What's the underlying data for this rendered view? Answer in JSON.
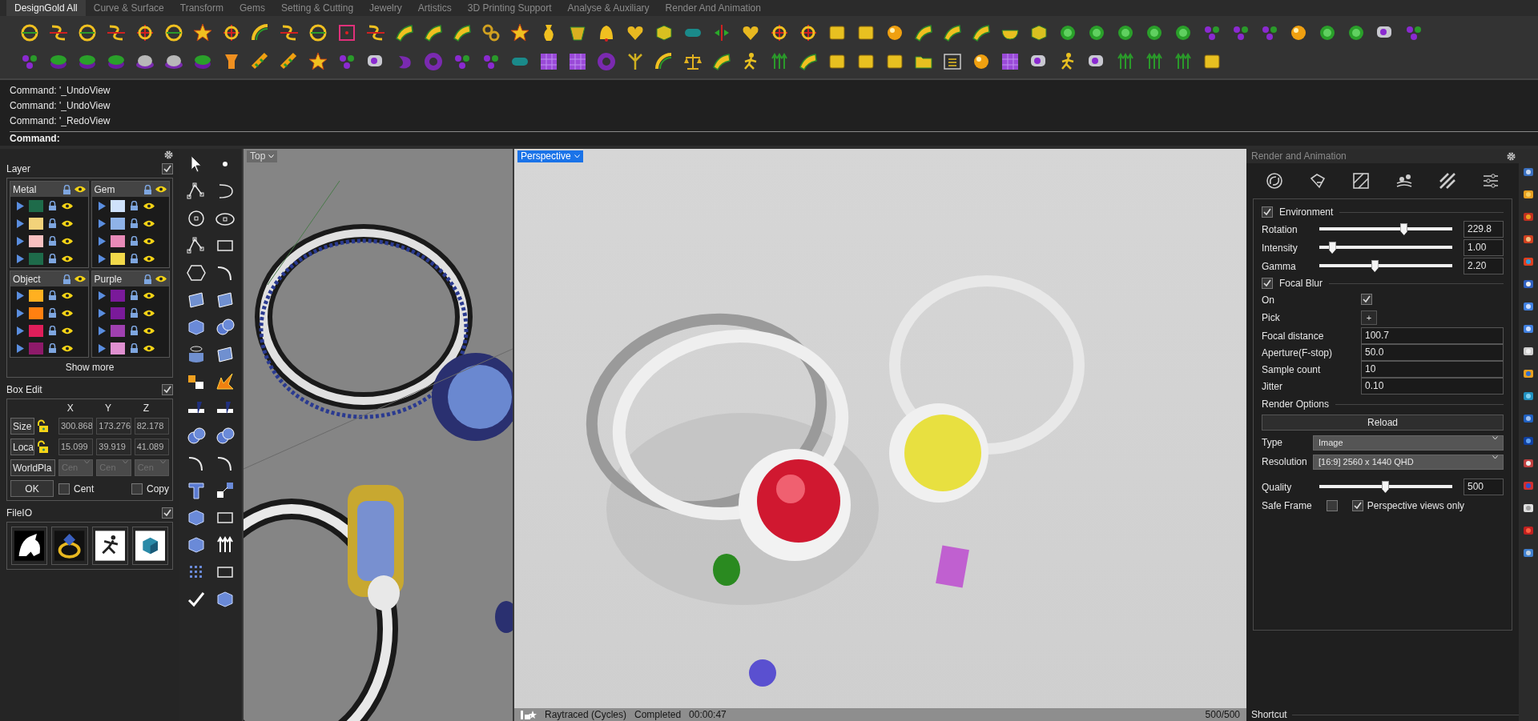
{
  "tabs": [
    {
      "label": "DesignGold All",
      "selected": true
    },
    {
      "label": "Curve & Surface",
      "selected": false
    },
    {
      "label": "Transform",
      "selected": false
    },
    {
      "label": "Gems",
      "selected": false
    },
    {
      "label": "Setting & Cutting",
      "selected": false
    },
    {
      "label": "Jewelry",
      "selected": false
    },
    {
      "label": "Artistics",
      "selected": false
    },
    {
      "label": "3D Printing Support",
      "selected": false
    },
    {
      "label": "Analyse & Auxiliary",
      "selected": false
    },
    {
      "label": "Render And Animation",
      "selected": false
    }
  ],
  "command_history": [
    "Command: '_UndoView",
    "Command: '_UndoView",
    "Command: '_RedoView"
  ],
  "command_prompt": "Command:",
  "layer_panel": {
    "title": "Layer",
    "checked": true,
    "show_more": "Show more",
    "groups": [
      {
        "name": "Metal",
        "layers": [
          {
            "color": "#1e6b4a"
          },
          {
            "color": "#f2d27a"
          },
          {
            "color": "#f8c0c0"
          },
          {
            "color": "#1e6b4a"
          }
        ]
      },
      {
        "name": "Gem",
        "layers": [
          {
            "color": "#cfe2fb"
          },
          {
            "color": "#8fb3e8"
          },
          {
            "color": "#e88ab8"
          },
          {
            "color": "#f2d94a"
          }
        ]
      },
      {
        "name": "Object",
        "layers": [
          {
            "color": "#ffb020"
          },
          {
            "color": "#ff8010"
          },
          {
            "color": "#e01e5a"
          },
          {
            "color": "#8e1a6a"
          }
        ]
      },
      {
        "name": "Purple",
        "layers": [
          {
            "color": "#7a1a9a"
          },
          {
            "color": "#7a1a9a"
          },
          {
            "color": "#a040b0"
          },
          {
            "color": "#e090d0"
          }
        ]
      }
    ]
  },
  "box_edit": {
    "title": "Box Edit",
    "checked": true,
    "axes": [
      "X",
      "Y",
      "Z"
    ],
    "rows": [
      {
        "label": "Size",
        "values": [
          "300.868",
          "173.276",
          "82.178"
        ]
      },
      {
        "label": "Loca",
        "values": [
          "15.099",
          "39.919",
          "41.089"
        ]
      }
    ],
    "plane": {
      "label": "WorldPla",
      "options": [
        {
          "value": "Cen",
          "disabled": true
        },
        {
          "value": "Cen",
          "disabled": true
        },
        {
          "value": "Cen",
          "disabled": true
        }
      ]
    },
    "ok": "OK",
    "options": [
      {
        "label": "Cent",
        "checked": false
      },
      {
        "label": "Copy",
        "checked": false
      }
    ]
  },
  "fileio": {
    "title": "FileIO",
    "checked": true
  },
  "viewports": [
    {
      "label": "Top",
      "selected": false
    },
    {
      "label": "Perspective",
      "selected": true
    }
  ],
  "render_status": {
    "mode": "Raytraced (Cycles)",
    "state": "Completed",
    "time": "00:00:47",
    "passes": "500/500"
  },
  "render_panel": {
    "title": "Render and Animation",
    "environment": {
      "label": "Environment",
      "checked": true
    },
    "sliders": [
      {
        "label": "Rotation",
        "level": 0.64,
        "value": "229.8"
      },
      {
        "label": "Intensity",
        "level": 0.1,
        "value": "1.00"
      },
      {
        "label": "Gamma",
        "level": 0.42,
        "value": "2.20"
      }
    ],
    "focal_blur": {
      "label": "Focal Blur",
      "checked": true
    },
    "on": {
      "label": "On",
      "checked": true
    },
    "pick": {
      "label": "Pick",
      "button": "+"
    },
    "fields": [
      {
        "label": "Focal distance",
        "value": "100.7"
      },
      {
        "label": "Aperture(F-stop)",
        "value": "50.0"
      },
      {
        "label": "Sample count",
        "value": "10"
      },
      {
        "label": "Jitter",
        "value": "0.10"
      }
    ],
    "render_options": "Render Options",
    "reload": "Reload",
    "type": {
      "label": "Type",
      "value": "Image"
    },
    "resolution": {
      "label": "Resolution",
      "value": "[16:9] 2560 x 1440 QHD"
    },
    "quality": {
      "label": "Quality",
      "level": 0.5,
      "value": "500"
    },
    "safe_frame": {
      "label": "Safe Frame",
      "checked": false
    },
    "perspective_only": {
      "label": "Perspective views only",
      "checked": true
    }
  },
  "shortcut": "Shortcut"
}
